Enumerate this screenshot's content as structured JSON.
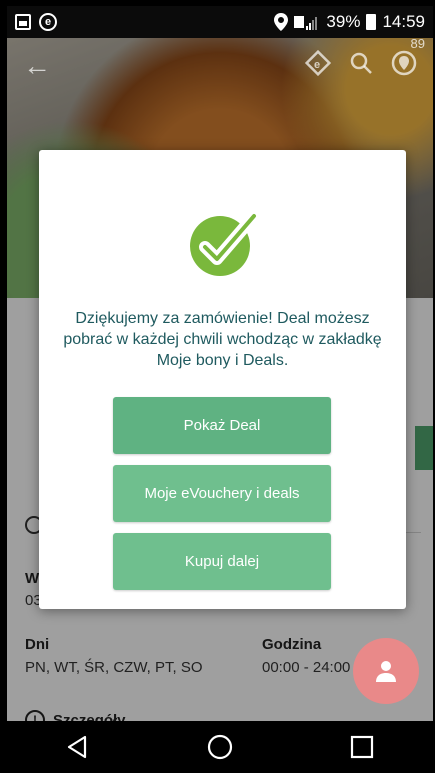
{
  "status_bar": {
    "battery_percent": "39%",
    "time": "14:59"
  },
  "toolbar": {
    "badge_count": "89"
  },
  "background_page": {
    "w_label": "W",
    "w_number": "03",
    "days_label": "Dni",
    "days_value": "PN, WT, ŚR, CZW, PT, SO",
    "hours_label": "Godzina",
    "hours_value": "00:00 - 24:00",
    "details_label": "Szczegóły"
  },
  "dialog": {
    "message": "Dziękujemy za zamówienie! Deal możesz pobrać w każdej chwili wchodząc w zakładkę Moje bony i Deals.",
    "buttons": [
      {
        "label": "Pokaż Deal",
        "color": "#5fb282"
      },
      {
        "label": "Moje eVouchery i deals",
        "color": "#6fbf8e"
      },
      {
        "label": "Kupuj dalej",
        "color": "#6fbf8e"
      }
    ],
    "check_color": "#7ab83c"
  }
}
